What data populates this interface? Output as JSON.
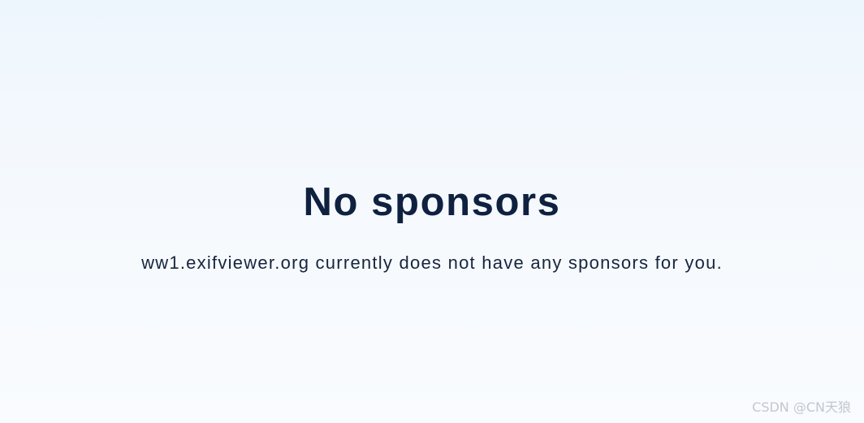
{
  "page": {
    "title": "No sponsors",
    "message": "ww1.exifviewer.org currently does not have any sponsors for you."
  },
  "watermark": {
    "text": "CSDN @CN天狼"
  },
  "colors": {
    "title": "#0f213f",
    "message": "#17253d",
    "background": "#f5f9fd",
    "watermark": "#b9bfc7"
  }
}
